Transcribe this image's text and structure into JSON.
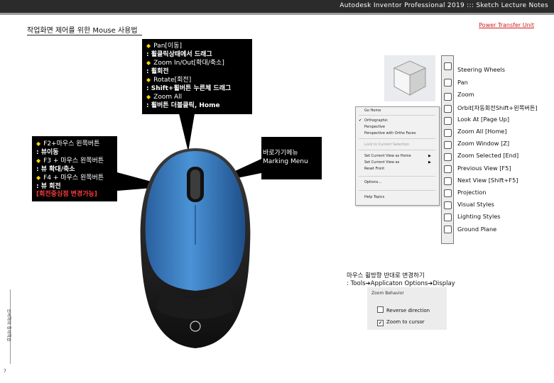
{
  "header": {
    "title": "Autodesk Inventor Professional 2019 ::: Sketch Lecture Notes",
    "unit_link": "Power Transfer Unit"
  },
  "section_title": "작업화면 제어를 위한 Mouse 사용법",
  "callout_top": {
    "lines": [
      {
        "text": "Pan[이동]",
        "bullet": true
      },
      {
        "text": ": 휠클릭상태에서 드래그",
        "bullet": false
      },
      {
        "text": "Zoom In/Out[확대/축소]",
        "bullet": true
      },
      {
        "text": ": 휠회전",
        "bullet": false
      },
      {
        "text": "Rotate[회전]",
        "bullet": true
      },
      {
        "text": ": Shift+휠버튼 누른체 드래그",
        "bullet": false
      },
      {
        "text": "Zoom All",
        "bullet": true
      },
      {
        "text": ": 휠버튼 더블클릭, Home",
        "bullet": false
      }
    ]
  },
  "callout_left": {
    "lines": [
      {
        "text": "F2+마우스 왼쪽버튼",
        "bullet": true,
        "red": false
      },
      {
        "text": ": 뷰이동",
        "bullet": false,
        "red": false
      },
      {
        "text": "F3 + 마우스 왼쪽버튼",
        "bullet": true,
        "red": false
      },
      {
        "text": ": 뷰 확대/축소",
        "bullet": false,
        "red": false
      },
      {
        "text": "F4 + 마우스 왼쪽버튼",
        "bullet": true,
        "red": false
      },
      {
        "text": ": 뷰 회전",
        "bullet": false,
        "red": false
      },
      {
        "text": "[회전중심점 변경가능]",
        "bullet": false,
        "red": true
      }
    ]
  },
  "callout_menu": {
    "line1": "바로가기메뉴",
    "line2": "Marking Menu"
  },
  "context_menu": {
    "items": [
      {
        "label": "Go Home",
        "disabled": false
      },
      {
        "label": "Orthographic",
        "disabled": false,
        "checked": true
      },
      {
        "label": "Perspective",
        "disabled": false
      },
      {
        "label": "Perspective with Ortho Faces",
        "disabled": false
      },
      {
        "label": "Lock to Current Selection",
        "disabled": true
      },
      {
        "label": "Set Current View as Home",
        "disabled": false,
        "submenu": true
      },
      {
        "label": "Set Current View as",
        "disabled": false,
        "submenu": true
      },
      {
        "label": "Reset Front",
        "disabled": false
      },
      {
        "label": "Options...",
        "disabled": false
      },
      {
        "label": "Help Topics",
        "disabled": false
      }
    ]
  },
  "nav_items": [
    "Steering Wheels",
    "Pan",
    "Zoom",
    "Orbit[자동회전Shift+왼쪽버튼]",
    "Look At [Page Up]",
    "Zoom All [Home]",
    "Zoom Window [Z]",
    "Zoom Selected [End]",
    "Previous View [F5]",
    "Next View [Shift+F5]",
    "Projection",
    "Visual Styles",
    "Lighting Styles",
    "Ground Plane"
  ],
  "reverse_note": {
    "title": "마우스 휠방향 반대로 변경하기",
    "subtitle": ": Tools➔Applicaton Options➔Display"
  },
  "zoom_behavior": {
    "legend": "Zoom Behavior",
    "reverse": {
      "label": "Reverse direction",
      "checked": false
    },
    "cursor": {
      "label": "Zoom to cursor",
      "checked": true
    }
  },
  "side_label": "신서혁의 창의학습",
  "page_number": "7",
  "colors": {
    "topbar": "#2b2b2b",
    "accent_red": "#d01a1a",
    "bullet": "#ffd400",
    "mouse_blue": "#3d7fc4"
  }
}
